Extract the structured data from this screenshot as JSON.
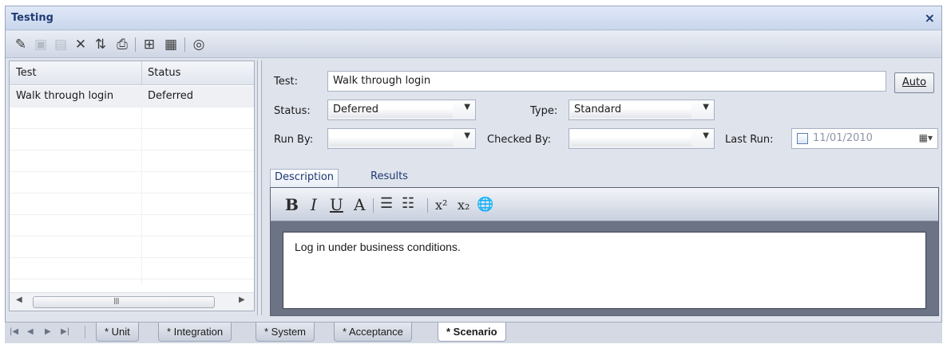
{
  "window": {
    "title": "Testing",
    "close_glyph": "×"
  },
  "toolbar": {
    "buttons": [
      {
        "icon": "new-test-icon",
        "glyph": "✎",
        "enabled": true
      },
      {
        "icon": "save-icon",
        "glyph": "▣",
        "enabled": false
      },
      {
        "icon": "paste-icon",
        "glyph": "▤",
        "enabled": false
      },
      {
        "icon": "delete-icon",
        "glyph": "✕",
        "enabled": true
      },
      {
        "icon": "sort-icon",
        "glyph": "⇅",
        "enabled": true
      },
      {
        "icon": "print-icon",
        "glyph": "⎙",
        "enabled": true
      },
      {
        "icon": "tree-icon",
        "glyph": "⊞",
        "enabled": true
      },
      {
        "icon": "report-icon",
        "glyph": "▦",
        "enabled": true
      },
      {
        "icon": "help-icon",
        "glyph": "◎",
        "enabled": true
      }
    ]
  },
  "test_list": {
    "columns": [
      "Test",
      "Status"
    ],
    "rows": [
      {
        "test": "Walk through login",
        "status": "Deferred"
      }
    ],
    "scroll_grip": "III"
  },
  "form": {
    "test_label": "Test:",
    "test_value": "Walk through login",
    "auto_button": "Auto",
    "status_label": "Status:",
    "status_value": "Deferred",
    "type_label": "Type:",
    "type_value": "Standard",
    "run_by_label": "Run By:",
    "run_by_value": "",
    "checked_by_label": "Checked By:",
    "checked_by_value": "",
    "last_run_label": "Last Run:",
    "last_run_value": "11/01/2010"
  },
  "detail_tabs": [
    "Description",
    "Results"
  ],
  "format_bar": {
    "bold": "B",
    "italic": "I",
    "underline": "U",
    "font_color": "A",
    "bullets": "☰",
    "numbering": "☷",
    "superscript": "x²",
    "subscript": "x₂",
    "hyperlink": "🌐"
  },
  "description_text": "Log in under business conditions.",
  "bottom_tabs": {
    "tabs": [
      "* Unit",
      "* Integration",
      "* System",
      "* Acceptance",
      "* Scenario"
    ],
    "active_index": 4,
    "nav": [
      "|◀",
      "◀",
      "▶",
      "▶|"
    ]
  },
  "colors": {
    "title_text": "#1f3a73",
    "panel_bg": "#dfe3ec",
    "editor_frame": "#6b7385"
  }
}
